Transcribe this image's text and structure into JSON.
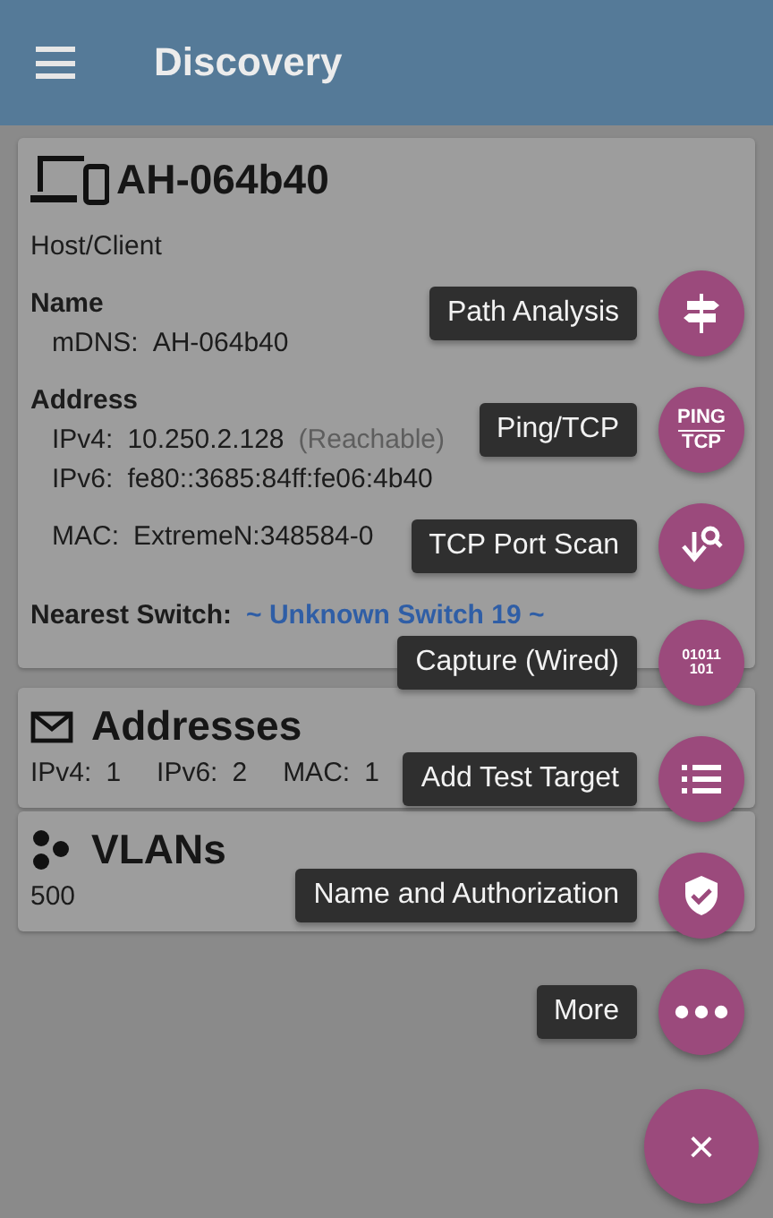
{
  "app_bar": {
    "title": "Discovery"
  },
  "device_card": {
    "title": "AH-064b40",
    "type": "Host/Client",
    "sections": [
      {
        "heading": "Name",
        "lines": [
          {
            "label": "mDNS:",
            "value": "AH-064b40"
          }
        ]
      },
      {
        "heading": "Address",
        "lines": [
          {
            "label": "IPv4:",
            "value": "10.250.2.128",
            "note": "(Reachable)"
          },
          {
            "label": "IPv6:",
            "value": "fe80::3685:84ff:fe06:4b40"
          },
          {
            "label": "MAC:",
            "value": "ExtremeN:348584-0"
          }
        ]
      }
    ],
    "nearest_switch": {
      "label": "Nearest Switch:",
      "value": "~ Unknown Switch 19 ~"
    }
  },
  "addresses_card": {
    "title": "Addresses",
    "counts": [
      {
        "label": "IPv4:",
        "value": "1"
      },
      {
        "label": "IPv6:",
        "value": "2"
      },
      {
        "label": "MAC:",
        "value": "1"
      }
    ]
  },
  "vlans_card": {
    "title": "VLANs",
    "value": "500"
  },
  "fab_menu": [
    {
      "label": "Path Analysis",
      "kind": "signpost"
    },
    {
      "label": "Ping/TCP",
      "kind": "ping",
      "icon_text": [
        "PING",
        "TCP"
      ]
    },
    {
      "label": "TCP Port Scan",
      "kind": "scan"
    },
    {
      "label": "Capture (Wired)",
      "kind": "capture",
      "icon_text": [
        "01011",
        "101"
      ]
    },
    {
      "label": "Add Test Target",
      "kind": "list"
    },
    {
      "label": "Name and Authorization",
      "kind": "shield"
    },
    {
      "label": "More",
      "kind": "more"
    }
  ],
  "close_fab": {
    "label": "×"
  }
}
